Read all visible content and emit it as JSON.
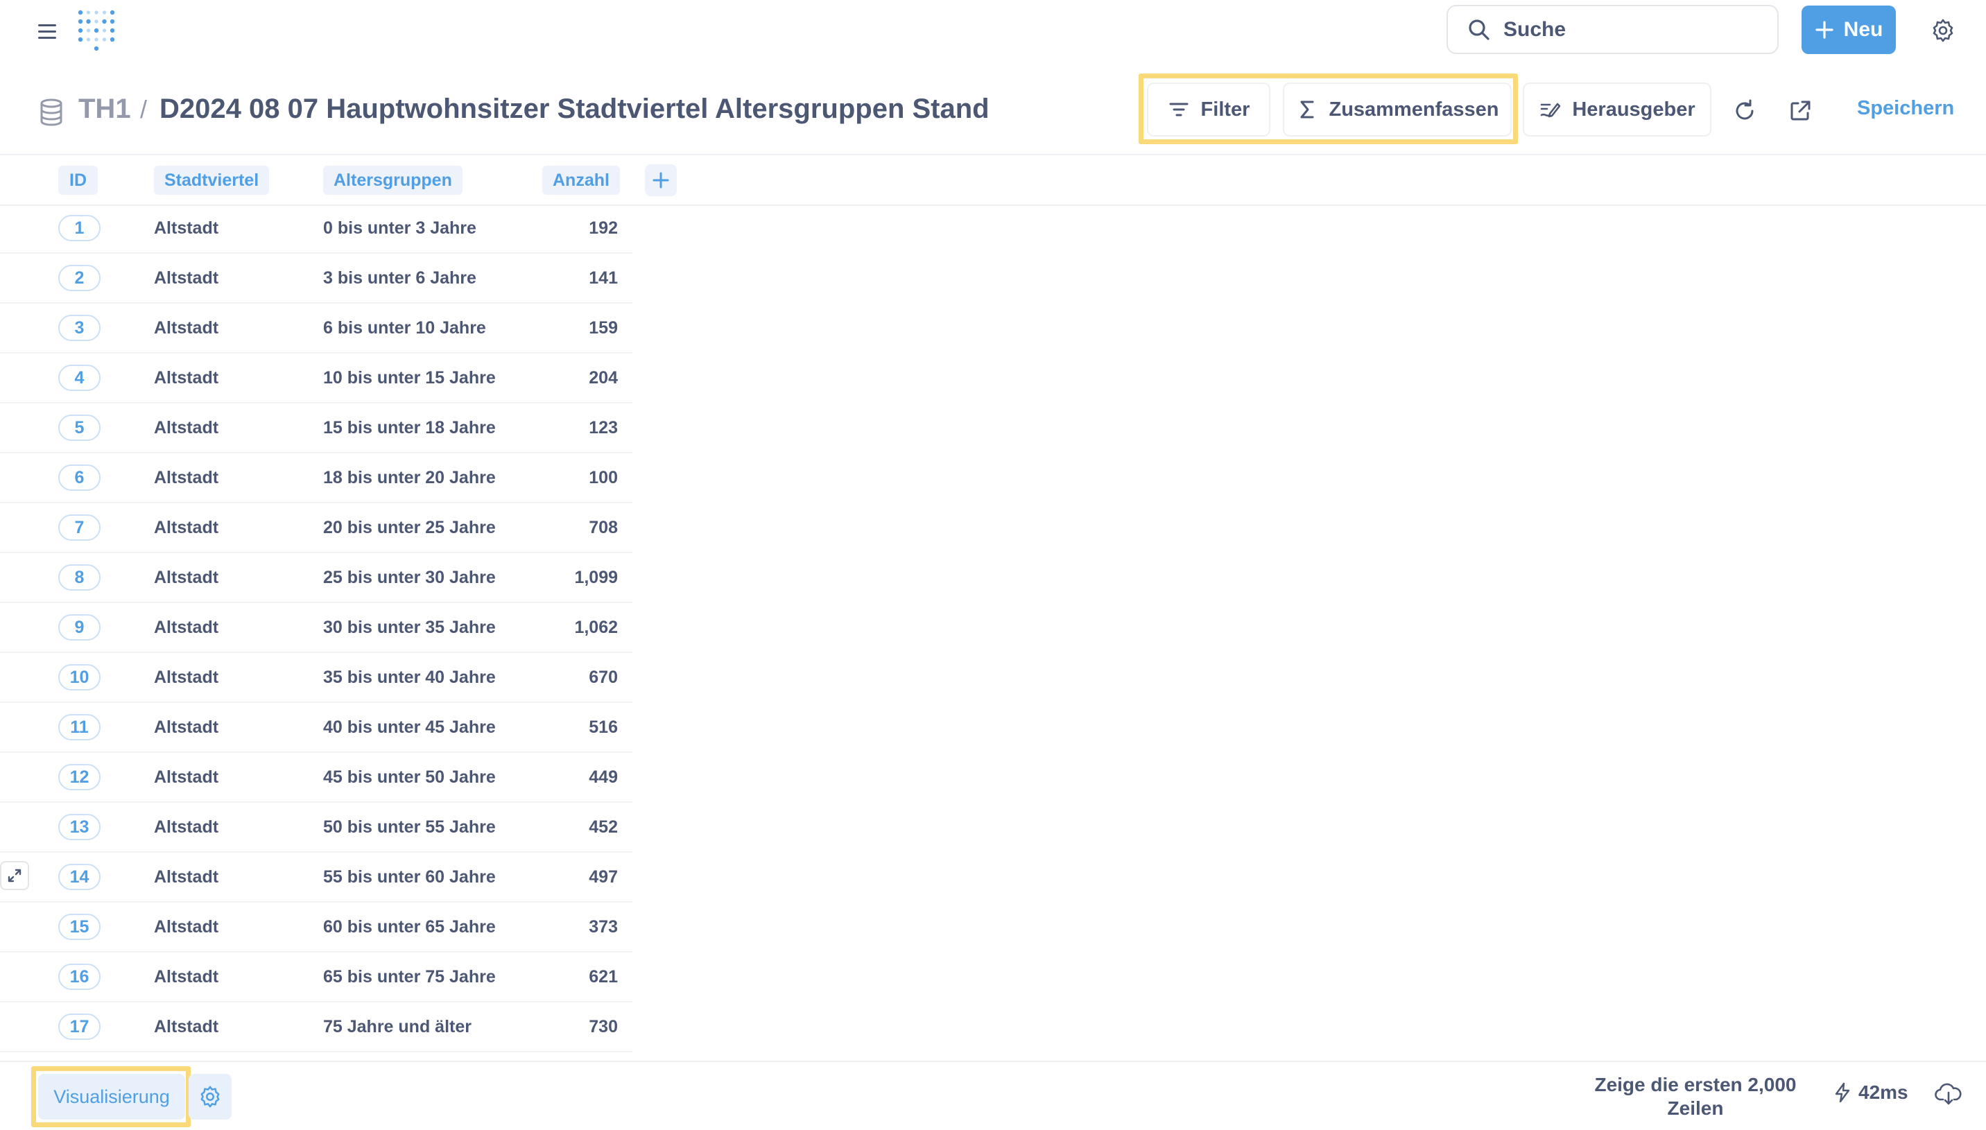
{
  "nav": {
    "search_placeholder": "Suche",
    "new_label": "Neu",
    "accent_color": "#509ee3"
  },
  "header": {
    "database": "TH1",
    "separator": "/",
    "title": "D2024 08 07 Hauptwohnsitzer Stadtviertel Altersgruppen Stand",
    "filter_label": "Filter",
    "summarize_label": "Zusammenfassen",
    "editor_label": "Herausgeber",
    "save_label": "Speichern",
    "icons": [
      "database-icon",
      "filter-icon",
      "sigma-icon",
      "notebook-edit-icon",
      "refresh-icon",
      "external-link-icon"
    ]
  },
  "table": {
    "columns": [
      "ID",
      "Stadtviertel",
      "Altersgruppen",
      "Anzahl"
    ],
    "rows": [
      {
        "id": "1",
        "stadtviertel": "Altstadt",
        "altersgruppe": "0 bis unter 3 Jahre",
        "anzahl": "192"
      },
      {
        "id": "2",
        "stadtviertel": "Altstadt",
        "altersgruppe": "3 bis unter 6 Jahre",
        "anzahl": "141"
      },
      {
        "id": "3",
        "stadtviertel": "Altstadt",
        "altersgruppe": "6 bis unter 10 Jahre",
        "anzahl": "159"
      },
      {
        "id": "4",
        "stadtviertel": "Altstadt",
        "altersgruppe": "10 bis unter 15 Jahre",
        "anzahl": "204"
      },
      {
        "id": "5",
        "stadtviertel": "Altstadt",
        "altersgruppe": "15 bis unter 18 Jahre",
        "anzahl": "123"
      },
      {
        "id": "6",
        "stadtviertel": "Altstadt",
        "altersgruppe": "18 bis unter 20 Jahre",
        "anzahl": "100"
      },
      {
        "id": "7",
        "stadtviertel": "Altstadt",
        "altersgruppe": "20 bis unter 25 Jahre",
        "anzahl": "708"
      },
      {
        "id": "8",
        "stadtviertel": "Altstadt",
        "altersgruppe": "25 bis unter 30 Jahre",
        "anzahl": "1,099"
      },
      {
        "id": "9",
        "stadtviertel": "Altstadt",
        "altersgruppe": "30 bis unter 35 Jahre",
        "anzahl": "1,062"
      },
      {
        "id": "10",
        "stadtviertel": "Altstadt",
        "altersgruppe": "35 bis unter 40 Jahre",
        "anzahl": "670"
      },
      {
        "id": "11",
        "stadtviertel": "Altstadt",
        "altersgruppe": "40 bis unter 45 Jahre",
        "anzahl": "516"
      },
      {
        "id": "12",
        "stadtviertel": "Altstadt",
        "altersgruppe": "45 bis unter 50 Jahre",
        "anzahl": "449"
      },
      {
        "id": "13",
        "stadtviertel": "Altstadt",
        "altersgruppe": "50 bis unter 55 Jahre",
        "anzahl": "452"
      },
      {
        "id": "14",
        "stadtviertel": "Altstadt",
        "altersgruppe": "55 bis unter 60 Jahre",
        "anzahl": "497"
      },
      {
        "id": "15",
        "stadtviertel": "Altstadt",
        "altersgruppe": "60 bis unter 65 Jahre",
        "anzahl": "373"
      },
      {
        "id": "16",
        "stadtviertel": "Altstadt",
        "altersgruppe": "65 bis unter 75 Jahre",
        "anzahl": "621"
      },
      {
        "id": "17",
        "stadtviertel": "Altstadt",
        "altersgruppe": "75 Jahre und älter",
        "anzahl": "730"
      }
    ]
  },
  "footer": {
    "visualize_label": "Visualisierung",
    "row_count_line1": "Zeige die ersten 2,000",
    "row_count_line2": "Zeilen",
    "timing": "42ms"
  },
  "highlight_color": "#f9d97a"
}
